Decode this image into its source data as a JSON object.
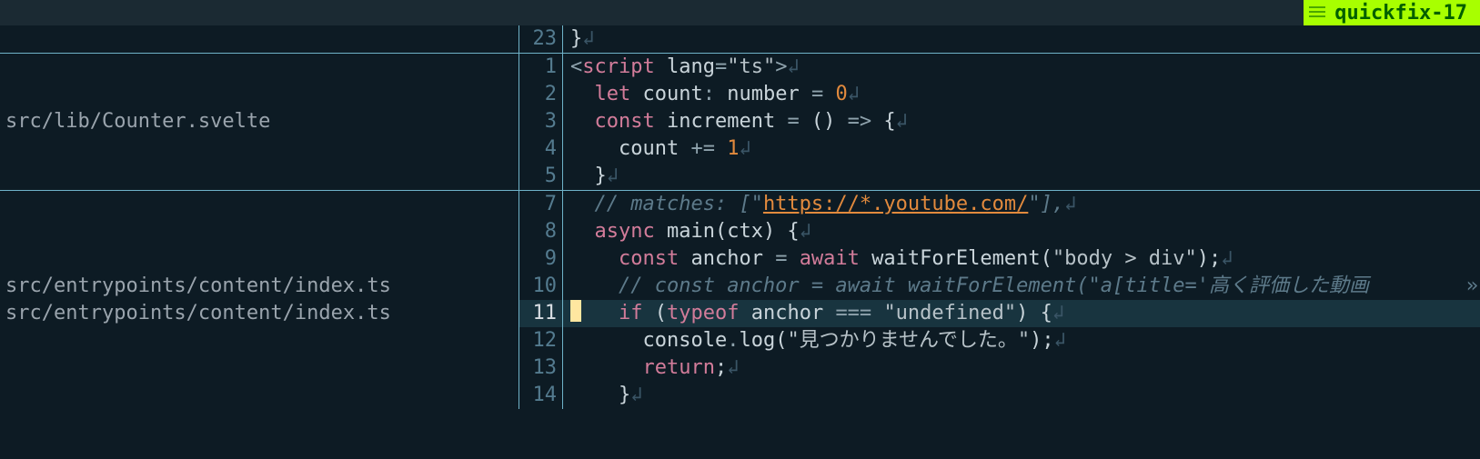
{
  "badge": {
    "label": "quickfix-17"
  },
  "panes": [
    {
      "files": [],
      "lines": [
        {
          "n": 23,
          "tokens": [
            {
              "t": "}",
              "c": "fn"
            },
            {
              "t": "↲",
              "c": "eol"
            }
          ]
        }
      ]
    },
    {
      "files": [
        "src/lib/Counter.svelte"
      ],
      "lines": [
        {
          "n": 1,
          "tokens": [
            {
              "t": "<",
              "c": "op"
            },
            {
              "t": "script",
              "c": "tag"
            },
            {
              "t": " lang",
              "c": "fn"
            },
            {
              "t": "=",
              "c": "op"
            },
            {
              "t": "\"ts\"",
              "c": "str"
            },
            {
              "t": ">",
              "c": "op"
            },
            {
              "t": "↲",
              "c": "eol"
            }
          ]
        },
        {
          "n": 2,
          "tokens": [
            {
              "t": "  ",
              "c": ""
            },
            {
              "t": "let",
              "c": "kw"
            },
            {
              "t": " count",
              "c": "fn"
            },
            {
              "t": ":",
              "c": "op"
            },
            {
              "t": " number ",
              "c": "type"
            },
            {
              "t": "=",
              "c": "op"
            },
            {
              "t": " ",
              "c": ""
            },
            {
              "t": "0",
              "c": "num"
            },
            {
              "t": "↲",
              "c": "eol"
            }
          ]
        },
        {
          "n": 3,
          "tokens": [
            {
              "t": "  ",
              "c": ""
            },
            {
              "t": "const",
              "c": "kw"
            },
            {
              "t": " increment ",
              "c": "fn"
            },
            {
              "t": "=",
              "c": "op"
            },
            {
              "t": " () ",
              "c": "fn"
            },
            {
              "t": "=>",
              "c": "op"
            },
            {
              "t": " {",
              "c": "fn"
            },
            {
              "t": "↲",
              "c": "eol"
            }
          ]
        },
        {
          "n": 4,
          "tokens": [
            {
              "t": "    ",
              "c": ""
            },
            {
              "t": "count ",
              "c": "fn"
            },
            {
              "t": "+=",
              "c": "op"
            },
            {
              "t": " ",
              "c": ""
            },
            {
              "t": "1",
              "c": "num"
            },
            {
              "t": "↲",
              "c": "eol"
            }
          ]
        },
        {
          "n": 5,
          "tokens": [
            {
              "t": "  }",
              "c": "fn"
            },
            {
              "t": "↲",
              "c": "eol"
            }
          ]
        }
      ]
    },
    {
      "files": [
        "src/entrypoints/content/index.ts",
        "src/entrypoints/content/index.ts"
      ],
      "current_index": 4,
      "lines": [
        {
          "n": 7,
          "tokens": [
            {
              "t": "  ",
              "c": "indent"
            },
            {
              "t": "// matches: [\"",
              "c": "cmt"
            },
            {
              "t": "https://*.youtube.com/",
              "c": "link"
            },
            {
              "t": "\"],",
              "c": "cmt"
            },
            {
              "t": "↲",
              "c": "eol"
            }
          ]
        },
        {
          "n": 8,
          "tokens": [
            {
              "t": "  ",
              "c": "indent"
            },
            {
              "t": "async",
              "c": "kw"
            },
            {
              "t": " main(ctx) {",
              "c": "fn"
            },
            {
              "t": "↲",
              "c": "eol"
            }
          ]
        },
        {
          "n": 9,
          "tokens": [
            {
              "t": "    ",
              "c": "indent"
            },
            {
              "t": "const",
              "c": "kw"
            },
            {
              "t": " anchor ",
              "c": "fn"
            },
            {
              "t": "=",
              "c": "op"
            },
            {
              "t": " ",
              "c": ""
            },
            {
              "t": "await",
              "c": "kw"
            },
            {
              "t": " waitForElement(",
              "c": "fn"
            },
            {
              "t": "\"body > div\"",
              "c": "str"
            },
            {
              "t": ");",
              "c": "fn"
            },
            {
              "t": "↲",
              "c": "eol"
            }
          ]
        },
        {
          "n": 10,
          "wrap": true,
          "tokens": [
            {
              "t": "    ",
              "c": "indent"
            },
            {
              "t": "// const anchor = await waitForElement(\"a[title='高く評価した動画",
              "c": "cmt"
            }
          ]
        },
        {
          "n": 11,
          "cursor": true,
          "tokens": [
            {
              "t": "    ",
              "c": "indent"
            },
            {
              "t": "if",
              "c": "kw"
            },
            {
              "t": " (",
              "c": "fn"
            },
            {
              "t": "typeof",
              "c": "kw"
            },
            {
              "t": " anchor ",
              "c": "fn"
            },
            {
              "t": "===",
              "c": "op"
            },
            {
              "t": " ",
              "c": ""
            },
            {
              "t": "\"undefined\"",
              "c": "str"
            },
            {
              "t": ") {",
              "c": "fn"
            },
            {
              "t": "↲",
              "c": "eol"
            }
          ]
        },
        {
          "n": 12,
          "tokens": [
            {
              "t": "      ",
              "c": "indent"
            },
            {
              "t": "console",
              "c": "fn"
            },
            {
              "t": ".",
              "c": "op"
            },
            {
              "t": "log(",
              "c": "fn"
            },
            {
              "t": "\"見つかりませんでした。\"",
              "c": "str"
            },
            {
              "t": ");",
              "c": "fn"
            },
            {
              "t": "↲",
              "c": "eol"
            }
          ]
        },
        {
          "n": 13,
          "tokens": [
            {
              "t": "      ",
              "c": "indent"
            },
            {
              "t": "return",
              "c": "kw"
            },
            {
              "t": ";",
              "c": "fn"
            },
            {
              "t": "↲",
              "c": "eol"
            }
          ]
        },
        {
          "n": 14,
          "tokens": [
            {
              "t": "    }",
              "c": "fn"
            },
            {
              "t": "↲",
              "c": "eol"
            }
          ]
        }
      ]
    }
  ]
}
